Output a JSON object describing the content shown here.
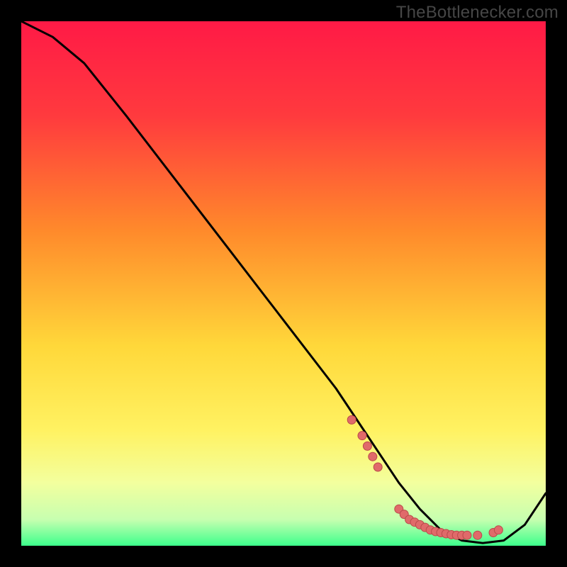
{
  "watermark": "TheBottlenecker.com",
  "colors": {
    "bg_black": "#000000",
    "grad_top": "#ff1a46",
    "grad_mid1": "#ff8a2b",
    "grad_mid2": "#ffe641",
    "grad_low": "#f5ff9a",
    "grad_green": "#3dff8c",
    "curve": "#000000",
    "marker_fill": "#e06a6a",
    "marker_stroke": "#b94a4a"
  },
  "chart_data": {
    "type": "line",
    "title": "",
    "xlabel": "",
    "ylabel": "",
    "xlim": [
      0,
      100
    ],
    "ylim": [
      0,
      100
    ],
    "curve": {
      "x": [
        0,
        6,
        12,
        20,
        30,
        40,
        50,
        60,
        68,
        72,
        76,
        80,
        84,
        88,
        92,
        96,
        100
      ],
      "y": [
        100,
        97,
        92,
        82,
        69,
        56,
        43,
        30,
        18,
        12,
        7,
        3,
        1,
        0.5,
        1,
        4,
        10
      ]
    },
    "markers": {
      "x": [
        63,
        65,
        66,
        67,
        68,
        72,
        73,
        74,
        75,
        76,
        77,
        78,
        79,
        80,
        81,
        82,
        83,
        84,
        85,
        87,
        90,
        91
      ],
      "y": [
        24,
        21,
        19,
        17,
        15,
        7,
        6,
        5,
        4.5,
        4,
        3.5,
        3,
        2.7,
        2.5,
        2.3,
        2.1,
        2,
        2,
        2,
        2,
        2.5,
        3
      ]
    }
  }
}
